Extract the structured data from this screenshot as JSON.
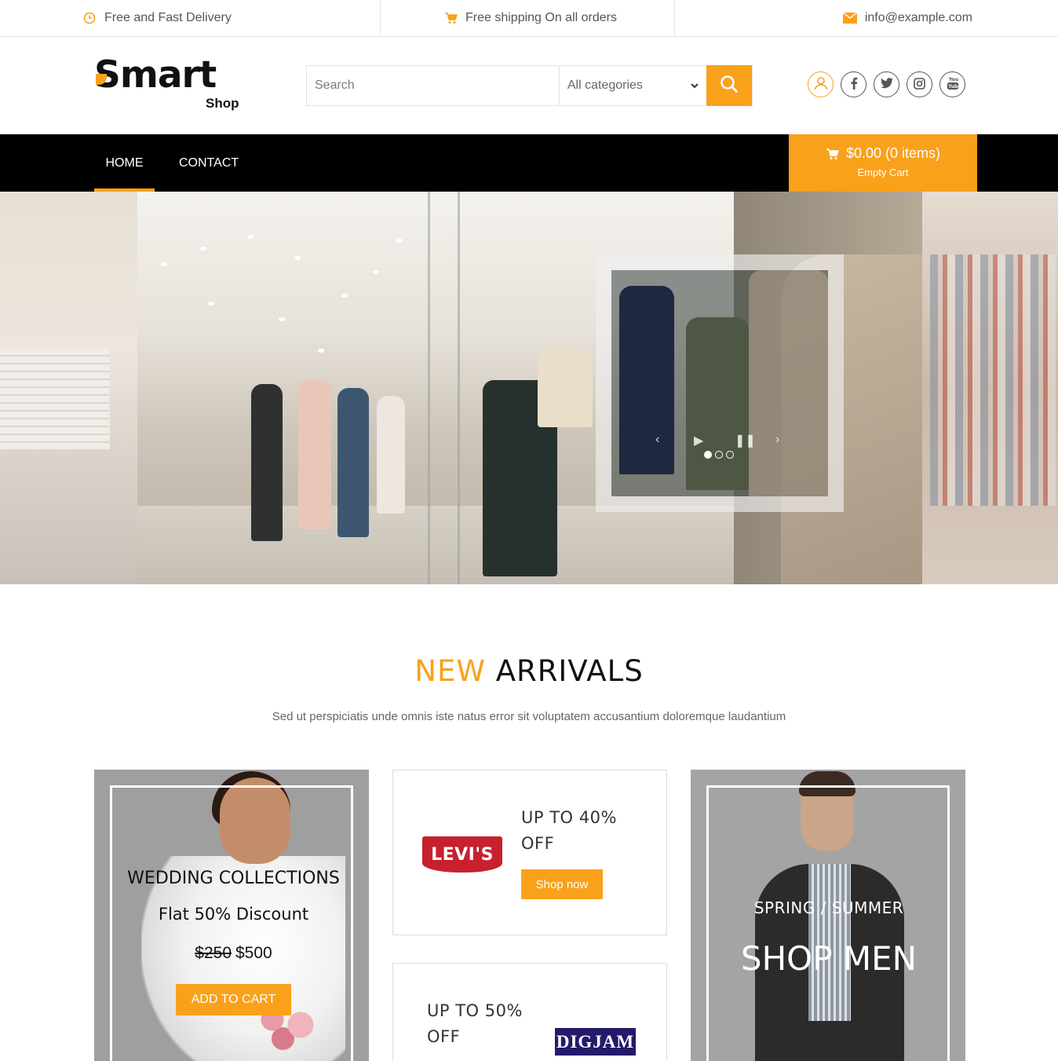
{
  "topbar": {
    "delivery": "Free and Fast Delivery",
    "shipping": "Free shipping On all orders",
    "email": "info@example.com",
    "delivery_icon": "clock-icon",
    "shipping_icon": "cart-icon",
    "email_icon": "envelope-icon"
  },
  "logo": {
    "word": "mart",
    "sub": "Shop",
    "letter": "S"
  },
  "search": {
    "placeholder": "Search",
    "category": "All categories"
  },
  "socials": [
    "user-icon",
    "facebook-icon",
    "twitter-icon",
    "instagram-icon",
    "youtube-icon"
  ],
  "nav": {
    "home": "HOME",
    "contact": "CONTACT"
  },
  "cart": {
    "total": "$0.00 (0 items)",
    "status": "Empty Cart"
  },
  "hero": {
    "slides": 3,
    "active_slide": 1
  },
  "section": {
    "title_accent": "NEW",
    "title_rest": "ARRIVALS",
    "subtitle": "Sed ut perspiciatis unde omnis iste natus error sit voluptatem accusantium doloremque laudantium"
  },
  "promo_bride": {
    "title": "WEDDING COLLECTIONS",
    "discount": "Flat 50% Discount",
    "old_price": "$250",
    "new_price": "$500",
    "button": "ADD TO CART"
  },
  "promo_levis": {
    "logo": "LEVI'S",
    "line1": "UP TO 40%",
    "line2": "OFF",
    "button": "Shop now"
  },
  "promo_digjam": {
    "logo": "DIGJAM",
    "line1": "UP TO 50%",
    "line2": "OFF"
  },
  "promo_men": {
    "line1": "SPRING / SUMMER",
    "line2": "SHOP MEN"
  },
  "colors": {
    "accent": "#f9a11b",
    "nav_bg": "#000000",
    "text": "#333333"
  }
}
